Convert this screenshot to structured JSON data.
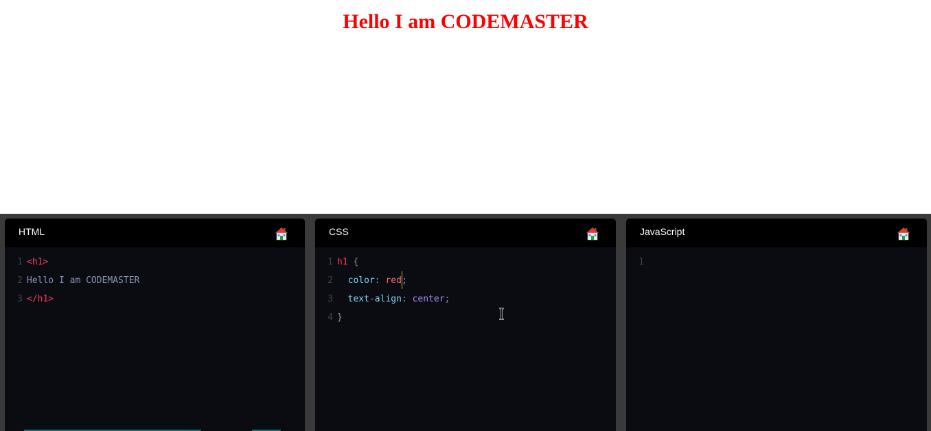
{
  "preview": {
    "heading": "Hello I am CODEMASTER"
  },
  "panes": {
    "html": {
      "title": "HTML",
      "home_icon": "home-icon",
      "lines": {
        "l1": {
          "num": "1",
          "text": "<h1>"
        },
        "l2": {
          "num": "2",
          "text": "Hello I am CODEMASTER"
        },
        "l3": {
          "num": "3",
          "text": "</h1>"
        }
      }
    },
    "css": {
      "title": "CSS",
      "home_icon": "home-icon",
      "lines": {
        "l1": {
          "num": "1",
          "selector": "h1",
          "brace": " {"
        },
        "l2": {
          "num": "2",
          "indent": "  ",
          "prop": "color",
          "colon": ": ",
          "value": "red",
          "semi": ";"
        },
        "l3": {
          "num": "3",
          "indent": "  ",
          "prop": "text-align",
          "colon": ": ",
          "value": "center",
          "semi": ";"
        },
        "l4": {
          "num": "4",
          "brace": "}"
        }
      }
    },
    "js": {
      "title": "JavaScript",
      "home_icon": "home-icon",
      "lines": {
        "l1": {
          "num": "1",
          "text": ""
        }
      }
    }
  },
  "colors": {
    "preview_heading": "#ff0000",
    "editor_bg": "#0b0c11",
    "header_bg": "#000000",
    "gutter": "#3a3a3a",
    "tag": "#ff3b5c",
    "property": "#7fd6f0",
    "value": "#a78bfa"
  }
}
